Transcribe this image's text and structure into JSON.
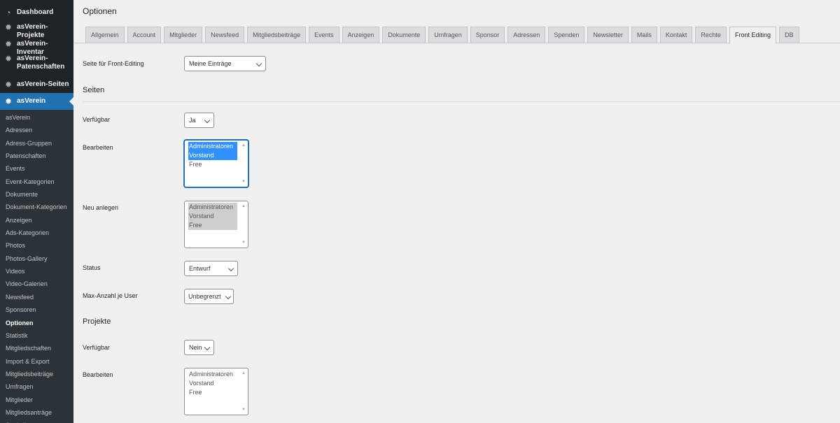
{
  "sidebar": {
    "top_items": [
      {
        "label": "Dashboard",
        "icon": "dashboard-icon"
      },
      {
        "label": "asVerein-Projekte",
        "icon": "gear-icon"
      },
      {
        "label": "asVerein-Inventar",
        "icon": "gear-icon"
      },
      {
        "label": "asVerein-Patenschaften",
        "icon": "gear-icon"
      },
      {
        "label": "asVerein-Seiten",
        "icon": "gear-icon"
      },
      {
        "label": "asVerein",
        "icon": "gear-icon"
      }
    ],
    "sub_items": [
      "asVerein",
      "Adressen",
      "Adress-Gruppen",
      "Patenschaften",
      "Events",
      "Event-Kategorien",
      "Dokumente",
      "Dokument-Kategorien",
      "Anzeigen",
      "Ads-Kategorien",
      "Photos",
      "Photos-Gallery",
      "Videos",
      "Video-Galerien",
      "Newsfeed",
      "Sponsoren",
      "Optionen",
      "Statistik",
      "Mitgliedschaften",
      "Import & Export",
      "Mitgliedsbeiträge",
      "Umfragen",
      "Mitglieder",
      "Mitgliedsanträge",
      "Statistiken"
    ],
    "current_sub": "Optionen",
    "active_color": "#2271b1"
  },
  "page": {
    "title": "Optionen",
    "tabs": [
      "Allgemein",
      "Account",
      "Mitglieder",
      "Newsfeed",
      "Mitgliedsbeiträge",
      "Events",
      "Anzeigen",
      "Dokumente",
      "Umfragen",
      "Sponsor",
      "Adressen",
      "Spenden",
      "Newsletter",
      "Mails",
      "Kontakt",
      "Rechte",
      "Front Editing",
      "DB"
    ],
    "active_tab": "Front Editing"
  },
  "form": {
    "front_editing_page": {
      "label": "Seite für Front-Editing",
      "value": "Meine Einträge"
    },
    "seiten": {
      "heading": "Seiten",
      "verfuegbar": {
        "label": "Verfügbar",
        "value": "Ja"
      },
      "bearbeiten": {
        "label": "Bearbeiten",
        "options": [
          "Administratoren",
          "Vorstand",
          "Free"
        ],
        "selected": [
          "Administratoren",
          "Vorstand"
        ]
      },
      "neu_anlegen": {
        "label": "Neu anlegen",
        "options": [
          "Administratoren",
          "Vorstand",
          "Free"
        ],
        "selected": [
          "Administratoren",
          "Vorstand",
          "Free"
        ]
      },
      "status": {
        "label": "Status",
        "value": "Entwurf"
      },
      "max_anzahl": {
        "label": "Max-Anzahl je User",
        "value": "Unbegrenzt"
      }
    },
    "projekte": {
      "heading": "Projekte",
      "verfuegbar": {
        "label": "Verfügbar",
        "value": "Nein"
      },
      "bearbeiten": {
        "label": "Bearbeiten",
        "options": [
          "Administratoren",
          "Vorstand",
          "Free"
        ],
        "selected": []
      }
    }
  }
}
